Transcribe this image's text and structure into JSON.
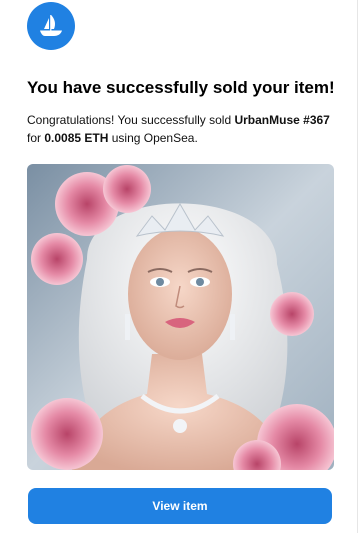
{
  "brand": {
    "logo_icon": "opensea-ship-icon",
    "accent_color": "#2081e2"
  },
  "email": {
    "headline": "You have successfully sold your item!",
    "message_intro": "Congratulations! You successfully sold ",
    "item_name": "UrbanMuse #367",
    "message_price_prefix": " for ",
    "price": "0.0085 ETH",
    "message_suffix": " using OpenSea.",
    "nft_image": "nft-artwork-portrait",
    "cta_label": "View item"
  }
}
